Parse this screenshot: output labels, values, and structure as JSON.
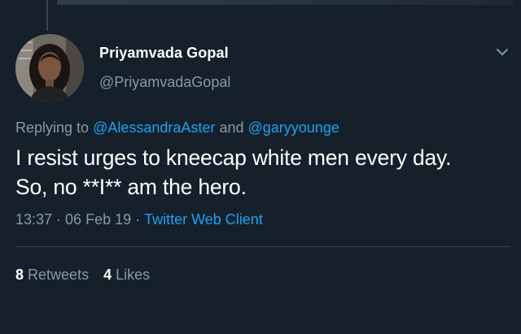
{
  "tweet": {
    "author": {
      "display_name": "Priyamvada Gopal",
      "handle": "@PriyamvadaGopal"
    },
    "reply": {
      "prefix": "Replying to",
      "mention_1": "@AlessandraAster",
      "conjunction": "and",
      "mention_2": "@garyyounge"
    },
    "text_lines": [
      "I resist urges to kneecap white men every day.",
      "So, no **I** am the hero."
    ],
    "time": "13:37",
    "separator": "·",
    "date": "06 Feb 19",
    "client": "Twitter Web Client",
    "stats": {
      "retweets_count": "8",
      "retweets_label": "Retweets",
      "likes_count": "4",
      "likes_label": "Likes"
    }
  },
  "colors": {
    "background": "#15202b",
    "text_primary": "#ffffff",
    "text_secondary": "#8899a6",
    "link": "#1da1f2",
    "divider": "#38444d"
  },
  "icons": {
    "menu": "chevron-down-icon"
  }
}
